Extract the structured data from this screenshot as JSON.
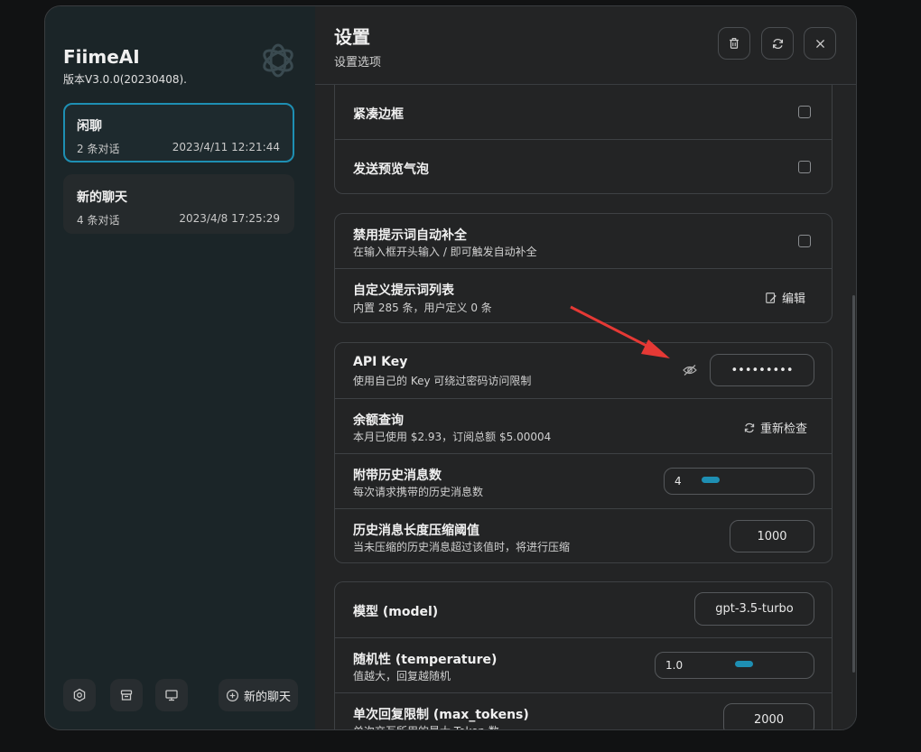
{
  "sidebar": {
    "title": "FiimeAI",
    "version": "版本V3.0.0(20230408).",
    "chats": [
      {
        "title": "闲聊",
        "count": "2 条对话",
        "date": "2023/4/11 12:21:44"
      },
      {
        "title": "新的聊天",
        "count": "4 条对话",
        "date": "2023/4/8 17:25:29"
      }
    ],
    "new_chat_label": "新的聊天"
  },
  "header": {
    "title": "设置",
    "subtitle": "设置选项"
  },
  "settings": {
    "compact_border": "紧凑边框",
    "send_preview": "发送预览气泡",
    "disable_prompt_title": "禁用提示词自动补全",
    "disable_prompt_sub": "在输入框开头输入 / 即可触发自动补全",
    "custom_prompts_title": "自定义提示词列表",
    "custom_prompts_sub": "内置 285 条，用户定义 0 条",
    "edit_label": "编辑",
    "api_key_title": "API Key",
    "api_key_sub": "使用自己的 Key 可绕过密码访问限制",
    "api_key_value": "•••••••••",
    "balance_title": "余额查询",
    "balance_sub": "本月已使用 $2.93，订阅总额 $5.00004",
    "recheck_label": "重新检查",
    "history_count_title": "附带历史消息数",
    "history_count_sub": "每次请求携带的历史消息数",
    "history_count_value": "4",
    "compress_title": "历史消息长度压缩阈值",
    "compress_sub": "当未压缩的历史消息超过该值时，将进行压缩",
    "compress_value": "1000",
    "model_title": "模型 (model)",
    "model_value": "gpt-3.5-turbo",
    "temperature_title": "随机性 (temperature)",
    "temperature_sub": "值越大，回复越随机",
    "temperature_value": "1.0",
    "max_tokens_title": "单次回复限制 (max_tokens)",
    "max_tokens_sub": "单次交互所用的最大 Token 数",
    "max_tokens_value": "2000"
  },
  "colors": {
    "accent": "#1e8fb3",
    "annotation_arrow": "#e53935"
  }
}
